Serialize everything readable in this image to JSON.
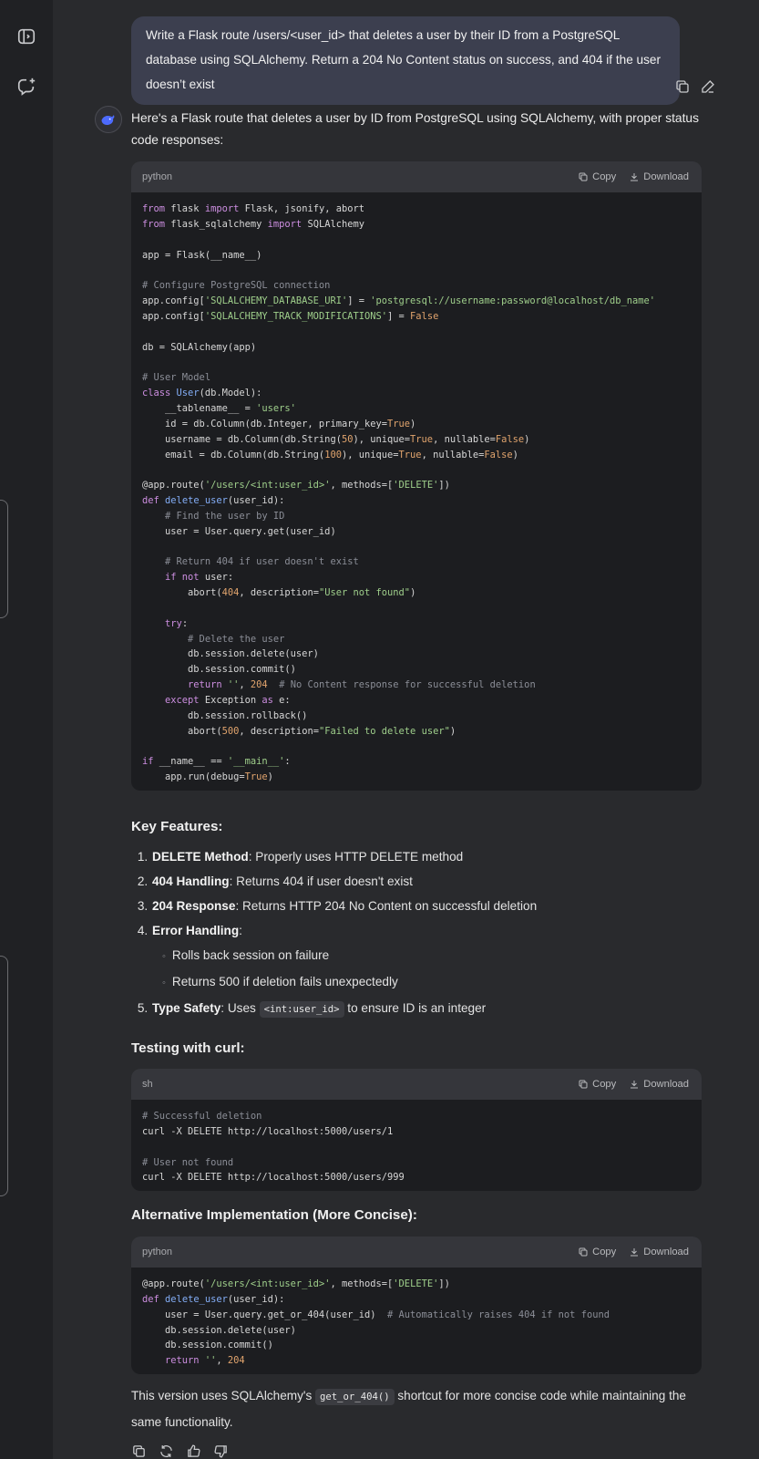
{
  "user_message": "Write a Flask route /users/<user_id> that deletes a user by their ID from a PostgreSQL database using SQLAlchemy. Return a 204 No Content status on success, and 404 if the user doesn’t exist",
  "answer": {
    "intro": "Here's a Flask route that deletes a user by ID from PostgreSQL using SQLAlchemy, with proper status code responses:",
    "code_blocks": [
      {
        "language": "python",
        "copy_label": "Copy",
        "download_label": "Download"
      },
      {
        "language": "sh",
        "copy_label": "Copy",
        "download_label": "Download"
      },
      {
        "language": "python",
        "copy_label": "Copy",
        "download_label": "Download"
      }
    ],
    "code1_lines": [
      "from flask import Flask, jsonify, abort",
      "from flask_sqlalchemy import SQLAlchemy",
      "",
      "app = Flask(__name__)",
      "",
      "# Configure PostgreSQL connection",
      "app.config['SQLALCHEMY_DATABASE_URI'] = 'postgresql://username:password@localhost/db_name'",
      "app.config['SQLALCHEMY_TRACK_MODIFICATIONS'] = False",
      "",
      "db = SQLAlchemy(app)",
      "",
      "# User Model",
      "class User(db.Model):",
      "    __tablename__ = 'users'",
      "    id = db.Column(db.Integer, primary_key=True)",
      "    username = db.Column(db.String(50), unique=True, nullable=False)",
      "    email = db.Column(db.String(100), unique=True, nullable=False)",
      "",
      "@app.route('/users/<int:user_id>', methods=['DELETE'])",
      "def delete_user(user_id):",
      "    # Find the user by ID",
      "    user = User.query.get(user_id)",
      "",
      "    # Return 404 if user doesn't exist",
      "    if not user:",
      "        abort(404, description=\"User not found\")",
      "",
      "    try:",
      "        # Delete the user",
      "        db.session.delete(user)",
      "        db.session.commit()",
      "        return '', 204  # No Content response for successful deletion",
      "    except Exception as e:",
      "        db.session.rollback()",
      "        abort(500, description=\"Failed to delete user\")",
      "",
      "if __name__ == '__main__':",
      "    app.run(debug=True)"
    ],
    "key_features_title": "Key Features:",
    "features": [
      {
        "bold": "DELETE Method",
        "text": ": Properly uses HTTP DELETE method"
      },
      {
        "bold": "404 Handling",
        "text": ": Returns 404 if user doesn't exist"
      },
      {
        "bold": "204 Response",
        "text": ": Returns HTTP 204 No Content on successful deletion"
      },
      {
        "bold": "Error Handling",
        "text": ":",
        "sub": [
          "Rolls back session on failure",
          "Returns 500 if deletion fails unexpectedly"
        ]
      },
      {
        "bold": "Type Safety",
        "text": ": Uses ",
        "code": "<int:user_id>",
        "text_after": " to ensure ID is an integer"
      }
    ],
    "testing_title": "Testing with curl:",
    "code2_lines": [
      "# Successful deletion",
      "curl -X DELETE http://localhost:5000/users/1",
      "",
      "# User not found",
      "curl -X DELETE http://localhost:5000/users/999"
    ],
    "alt_title": "Alternative Implementation (More Concise):",
    "code3_lines": [
      "@app.route('/users/<int:user_id>', methods=['DELETE'])",
      "def delete_user(user_id):",
      "    user = User.query.get_or_404(user_id)  # Automatically raises 404 if not found",
      "    db.session.delete(user)",
      "    db.session.commit()",
      "    return '', 204"
    ],
    "outro_before": "This version uses SQLAlchemy's ",
    "outro_code": "get_or_404()",
    "outro_after": " shortcut for more concise code while maintaining the same functionality."
  },
  "icons": {
    "sidebar": [
      "panel-toggle-icon",
      "new-chat-icon"
    ],
    "message_actions": [
      "copy-icon",
      "edit-icon"
    ],
    "answer_actions": [
      "copy-icon",
      "regenerate-icon",
      "thumbs-up-icon",
      "thumbs-down-icon"
    ]
  },
  "colors": {
    "background": "#292a2d",
    "sidebar": "#202124",
    "user_bubble": "#3c3f4f",
    "code_bg": "#1c1d20",
    "code_header": "#35363b",
    "accent": "#4d6bfe"
  }
}
